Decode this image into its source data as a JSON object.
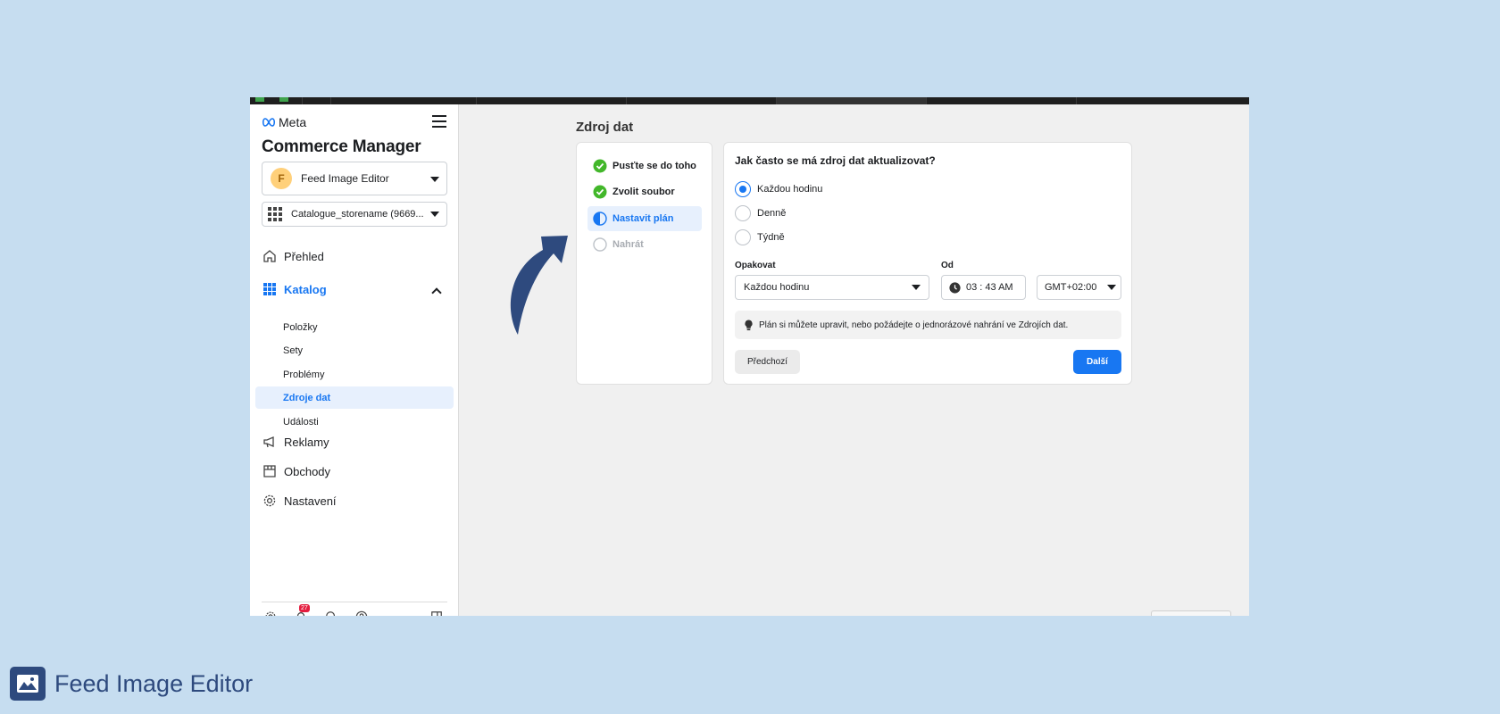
{
  "sidebar": {
    "logo": "Meta",
    "app_title": "Commerce Manager",
    "account": {
      "initial": "F",
      "name": "Feed Image Editor"
    },
    "catalogue": "Catalogue_storename (9669...",
    "nav": {
      "overview": "Přehled",
      "catalog": "Katalog",
      "catalog_items": [
        "Položky",
        "Sety",
        "Problémy",
        "Zdroje dat",
        "Události"
      ],
      "ads": "Reklamy",
      "shops": "Obchody",
      "settings": "Nastavení"
    },
    "notifications_count": "27"
  },
  "main": {
    "page_title": "Zdroj dat",
    "steps": [
      "Pusťte se do toho",
      "Zvolit soubor",
      "Nastavit plán",
      "Nahrát"
    ],
    "question": "Jak často se má zdroj dat aktualizovat?",
    "radio_options": [
      "Každou hodinu",
      "Denně",
      "Týdně"
    ],
    "selected_option": "Každou hodinu",
    "repeat_label": "Opakovat",
    "repeat_value": "Každou hodinu",
    "from_label": "Od",
    "time_value": "03 : 43 AM",
    "timezone": "GMT+02:00",
    "info_text": "Plán si můžete upravit, nebo požádejte o jednorázové nahrání ve Zdrojích dat.",
    "prev_button": "Předchozí",
    "next_button": "Další"
  },
  "brand": {
    "name": "Feed Image Editor"
  },
  "colors": {
    "accent": "#1877f2",
    "success": "#42b72a",
    "background": "#c6ddf0",
    "brand": "#2e4a7e",
    "arrow": "#2e4a7e"
  }
}
